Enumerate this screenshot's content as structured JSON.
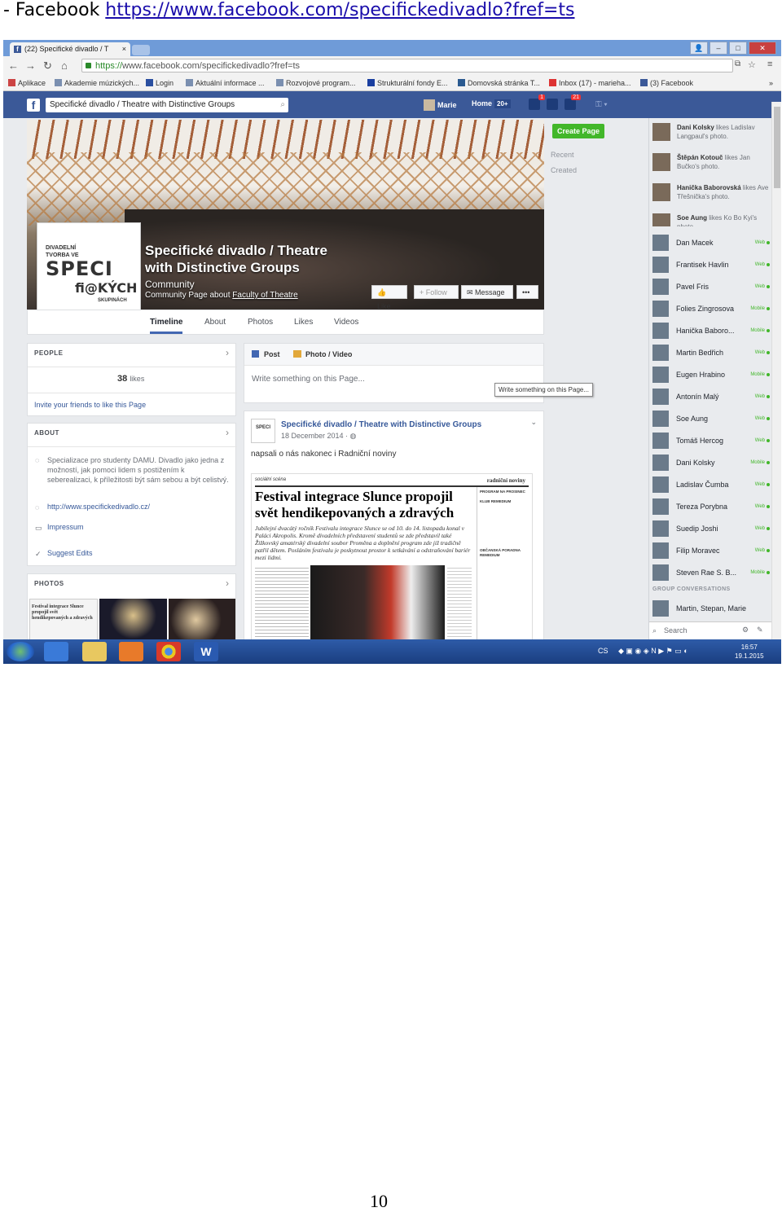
{
  "caption": {
    "prefix": "- Facebook ",
    "link": "https://www.facebook.com/specifickedivadlo?fref=ts"
  },
  "page_number": "10",
  "browser": {
    "tab_title": "(22) Specifické divadlo / T",
    "url_scheme": "https://",
    "url_rest": "www.facebook.com/specifickedivadlo?fref=ts",
    "bookmarks": [
      "Aplikace",
      "Akademie múzických...",
      "Login",
      "Aktuální informace ...",
      "Rozvojové program...",
      "Strukturální fondy E...",
      "Domovská stránka T...",
      "Inbox (17) - marieha...",
      "(3) Facebook"
    ]
  },
  "fb": {
    "search_value": "Specifické divadlo / Theatre with Distinctive Groups",
    "user": "Marie",
    "home": "Home",
    "home_count": "20+",
    "badge_friends": "1",
    "badge_notif": "21"
  },
  "page": {
    "name_line1": "Specifické divadlo / Theatre",
    "name_line2": "with Distinctive Groups",
    "category": "Community",
    "subtitle_prefix": "Community Page about ",
    "subtitle_link": "Faculty of Theatre",
    "btn_like": "Like",
    "btn_follow": "+ Follow",
    "btn_message": "Message",
    "btn_more": "•••",
    "logo_top1": "DIVADELNÍ",
    "logo_top2": "TVORBA VE",
    "logo_mid": "SPECI",
    "logo_fi": "fi@KÝCH",
    "logo_bot": "SKUPINÁCH",
    "tabs": [
      "Timeline",
      "About",
      "Photos",
      "Likes",
      "Videos"
    ]
  },
  "people": {
    "header": "PEOPLE",
    "count": "38",
    "likes": "likes",
    "invite": "Invite your friends to like this Page"
  },
  "about": {
    "header": "ABOUT",
    "desc": "Specializace pro studenty DAMU. Divadlo jako jedna z možností, jak pomoci lidem s postižením k seberealizaci, k příležitosti být sám sebou a být celistvý.",
    "website": "http://www.specifickedivadlo.cz/",
    "impressum": "Impressum",
    "suggest": "Suggest Edits"
  },
  "photos": {
    "header": "PHOTOS",
    "thumb_text": "Festival integrace Slunce propojil svět hendikepovaných a zdravých"
  },
  "composer": {
    "post": "Post",
    "photo": "Photo / Video",
    "placeholder": "Write something on this Page...",
    "tooltip": "Write something on this Page..."
  },
  "post": {
    "author": "Specifické divadlo / Theatre with Distinctive Groups",
    "date": "18 December 2014 · ",
    "text": "napsali o nás nakonec i Radniční noviny",
    "paper_left": "sociální scéna",
    "paper_right": "radniční noviny",
    "headline": "Festival integrace Slunce propojil svět hendikepovaných a zdravých",
    "lead": "Jubilejní dvacátý ročník Festivalu integrace Slunce se od 10. do 14. listopadu konal v Paláci Akropolis. Kromě divadelních představení studentů se zde představil také Žižkovský amatérský divadelní soubor Proměna a doplnění program zde již tradičně patřil dětem. Posláním festivalu je poskytnout prostor k setkávání a odstraňování bariér mezi lidmi.",
    "sidebar_title": "PROGRAM NA PROSINEC",
    "sidebar_club": "KLUB REMEDIUM",
    "sidebar_club2": "OBČANSKÁ PORADNA REMEDIUM"
  },
  "right": {
    "create_page": "Create Page",
    "recent": "Recent",
    "created": "Created"
  },
  "ticker": [
    {
      "name": "Dani Kolsky",
      "rest": " likes Ladislav Langpaul's photo."
    },
    {
      "name": "Štěpán Kotouč",
      "rest": " likes Jan Bučko's photo."
    },
    {
      "name": "Hanička Baborovská",
      "rest": " likes Ave Třešnička's photo."
    },
    {
      "name": "Soe Aung",
      "rest": " likes Ko Bo Kyi's photo."
    }
  ],
  "contacts": [
    {
      "name": "Dan Macek",
      "status": "Web"
    },
    {
      "name": "Frantisek Havlin",
      "status": "Web"
    },
    {
      "name": "Pavel Fris",
      "status": "Web"
    },
    {
      "name": "Folies Zingrosova",
      "status": "Mobile"
    },
    {
      "name": "Hanička Baboro...",
      "status": "Mobile"
    },
    {
      "name": "Martin Bedřich",
      "status": "Web"
    },
    {
      "name": "Eugen Hrabino",
      "status": "Mobile"
    },
    {
      "name": "Antonín Malý",
      "status": "Web"
    },
    {
      "name": "Soe Aung",
      "status": "Web"
    },
    {
      "name": "Tomáš Hercog",
      "status": "Web"
    },
    {
      "name": "Dani Kolsky",
      "status": "Mobile"
    },
    {
      "name": "Ladislav Čumba",
      "status": "Web"
    },
    {
      "name": "Tereza Porybna",
      "status": "Web"
    },
    {
      "name": "Suedip Joshi",
      "status": "Web"
    },
    {
      "name": "Filip Moravec",
      "status": "Web"
    },
    {
      "name": "Steven Rae S. B...",
      "status": "Mobile"
    }
  ],
  "group_conv": {
    "header": "GROUP CONVERSATIONS",
    "name": "Martin, Stepan, Marie"
  },
  "chat_search": "Search",
  "taskbar": {
    "lang": "CS",
    "time": "16:57",
    "date": "19.1.2015"
  }
}
